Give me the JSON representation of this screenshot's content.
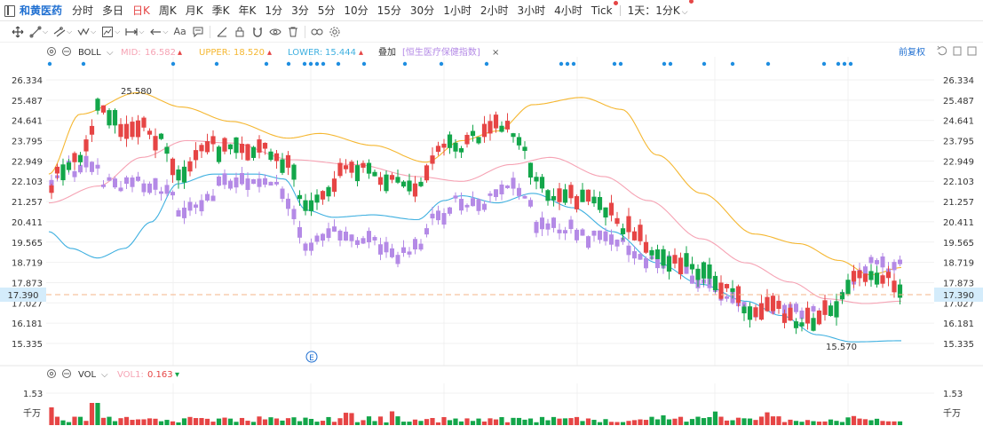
{
  "header": {
    "stock_name": "和黄医药",
    "periods": [
      {
        "label": "分时",
        "active": false,
        "dot": false
      },
      {
        "label": "多日",
        "active": false,
        "dot": false
      },
      {
        "label": "日K",
        "active": true,
        "dot": false
      },
      {
        "label": "周K",
        "active": false,
        "dot": false
      },
      {
        "label": "月K",
        "active": false,
        "dot": false
      },
      {
        "label": "季K",
        "active": false,
        "dot": false
      },
      {
        "label": "年K",
        "active": false,
        "dot": false
      },
      {
        "label": "1分",
        "active": false,
        "dot": false
      },
      {
        "label": "3分",
        "active": false,
        "dot": false
      },
      {
        "label": "5分",
        "active": false,
        "dot": false
      },
      {
        "label": "10分",
        "active": false,
        "dot": false
      },
      {
        "label": "15分",
        "active": false,
        "dot": false
      },
      {
        "label": "30分",
        "active": false,
        "dot": false
      },
      {
        "label": "1小时",
        "active": false,
        "dot": false
      },
      {
        "label": "2小时",
        "active": false,
        "dot": false
      },
      {
        "label": "3小时",
        "active": false,
        "dot": false
      },
      {
        "label": "4小时",
        "active": false,
        "dot": false
      },
      {
        "label": "Tick",
        "active": false,
        "dot": true
      }
    ],
    "multi_period": "1天：1分K"
  },
  "toolbar": {
    "text_tool_label": "Aa"
  },
  "main_chart": {
    "indicator": "BOLL",
    "mid_label": "MID:",
    "mid_value": "16.582",
    "upper_label": "UPPER:",
    "upper_value": "18.520",
    "lower_label": "LOWER:",
    "lower_value": "15.444",
    "overlay_label": "叠加",
    "overlay_value": "[恒生医疗保健指数]",
    "close_glyph": "×",
    "adjust_label": "前复权",
    "y_ticks": [
      "26.334",
      "25.487",
      "24.641",
      "23.795",
      "22.949",
      "22.103",
      "21.257",
      "20.411",
      "19.565",
      "18.719",
      "17.873",
      "17.027",
      "16.181",
      "15.335"
    ],
    "current_price": "17.390",
    "high_label": "25.580",
    "low_label": "15.570"
  },
  "volume_chart": {
    "indicator": "VOL",
    "vol1_label": "VOL1:",
    "vol1_value": "0.163",
    "y_ticks": [
      "1.53",
      "千万"
    ]
  },
  "colors": {
    "up": "#e64545",
    "down": "#13a64a",
    "overlay": "#b48ae6",
    "upper_band": "#f5b731",
    "mid_band": "#f6a3b4",
    "lower_band": "#3fb0e0",
    "dashed_price": "#f5b58a",
    "price_tag": "#d4ecfb",
    "accent": "#1f6fd1"
  }
}
